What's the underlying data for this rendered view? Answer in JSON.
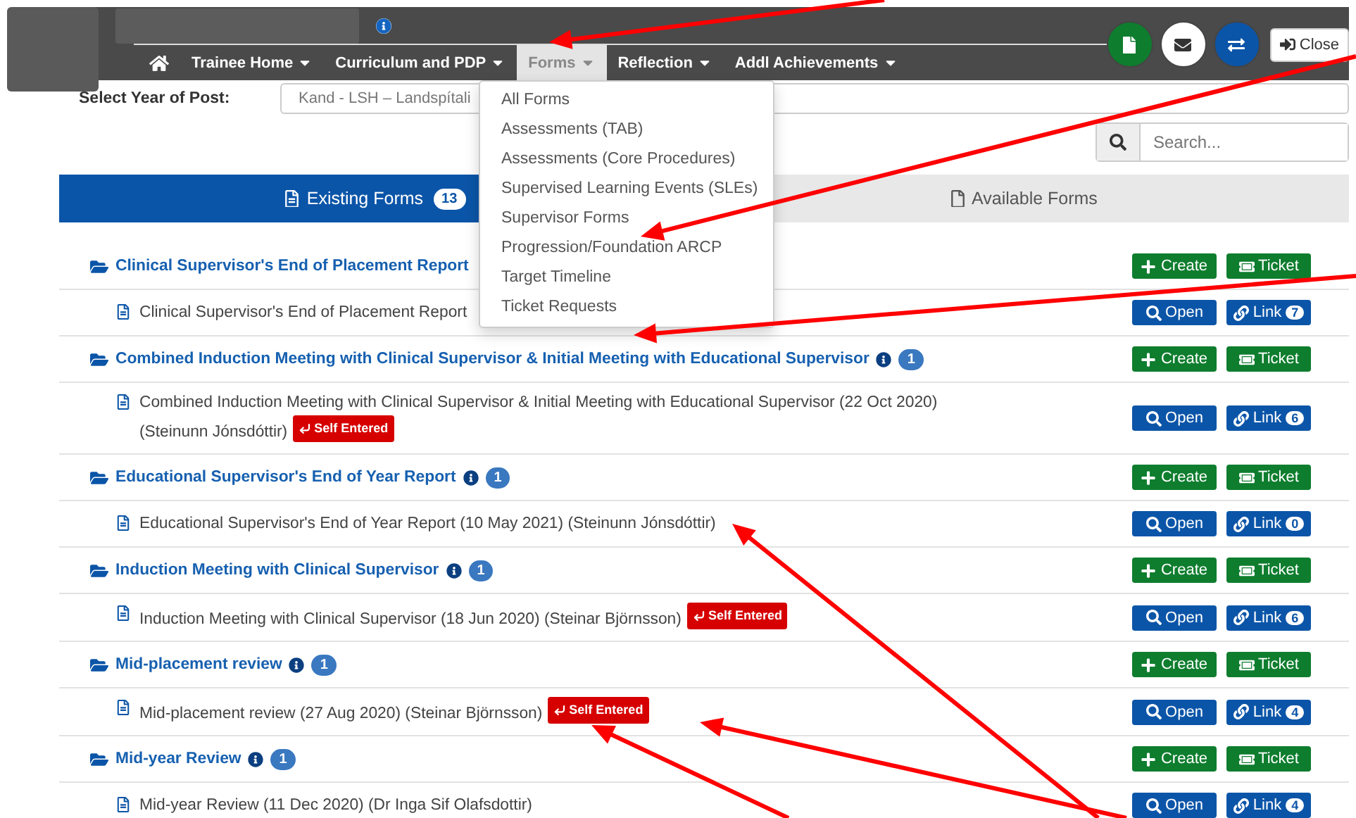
{
  "navbar": {
    "menu": [
      {
        "label": "Trainee Home",
        "selected": false
      },
      {
        "label": "Curriculum and PDP",
        "selected": false
      },
      {
        "label": "Forms",
        "selected": true
      },
      {
        "label": "Reflection",
        "selected": false
      },
      {
        "label": "Addl Achievements",
        "selected": false
      }
    ],
    "close_button": "Close"
  },
  "forms_menu": [
    "All Forms",
    "Assessments (TAB)",
    "Assessments (Core Procedures)",
    "Supervised Learning Events (SLEs)",
    "Supervisor Forms",
    "Progression/Foundation ARCP",
    "Target Timeline",
    "Ticket Requests"
  ],
  "year_select": {
    "label": "Select Year of Post:",
    "value": "Kand - LSH – Landspítali"
  },
  "search": {
    "placeholder": "Search..."
  },
  "tabs": [
    {
      "label": "Existing Forms",
      "count": "13",
      "selected": true
    },
    {
      "label": "Available Forms",
      "selected": false
    }
  ],
  "groups": [
    {
      "title": "Clinical Supervisor's End of Placement Report",
      "actions": [
        {
          "kind": "create",
          "label": "Create"
        },
        {
          "kind": "ticket",
          "label": "Ticket"
        }
      ],
      "items": [
        {
          "text": "Clinical Supervisor's End of Placement Report",
          "actions": [
            {
              "kind": "open",
              "label": "Open"
            },
            {
              "kind": "link",
              "label": "Link",
              "count": "7"
            }
          ]
        }
      ]
    },
    {
      "title": "Combined Induction Meeting with Clinical Supervisor & Initial Meeting with Educational Supervisor",
      "count": "1",
      "actions": [
        {
          "kind": "create",
          "label": "Create"
        },
        {
          "kind": "ticket",
          "label": "Ticket"
        }
      ],
      "items": [
        {
          "text": "Combined Induction Meeting with Clinical Supervisor & Initial Meeting with Educational Supervisor (22 Oct 2020) (Steinunn Jónsdóttir)",
          "badge": "Self Entered",
          "actions": [
            {
              "kind": "open",
              "label": "Open"
            },
            {
              "kind": "link",
              "label": "Link",
              "count": "6"
            }
          ]
        }
      ]
    },
    {
      "title": "Educational Supervisor's End of Year Report",
      "count": "1",
      "actions": [
        {
          "kind": "create",
          "label": "Create"
        },
        {
          "kind": "ticket",
          "label": "Ticket"
        }
      ],
      "items": [
        {
          "text": "Educational Supervisor's End of Year Report (10 May 2021) (Steinunn Jónsdóttir)",
          "actions": [
            {
              "kind": "open",
              "label": "Open"
            },
            {
              "kind": "link",
              "label": "Link",
              "count": "0"
            }
          ]
        }
      ]
    },
    {
      "title": "Induction Meeting with Clinical Supervisor",
      "count": "1",
      "actions": [
        {
          "kind": "create",
          "label": "Create"
        },
        {
          "kind": "ticket",
          "label": "Ticket"
        }
      ],
      "items": [
        {
          "text": "Induction Meeting with Clinical Supervisor (18 Jun 2020) (Steinar Björnsson)",
          "badge": "Self Entered",
          "actions": [
            {
              "kind": "open",
              "label": "Open"
            },
            {
              "kind": "link",
              "label": "Link",
              "count": "6"
            }
          ]
        }
      ]
    },
    {
      "title": "Mid-placement review",
      "count": "1",
      "actions": [
        {
          "kind": "create",
          "label": "Create"
        },
        {
          "kind": "ticket",
          "label": "Ticket"
        }
      ],
      "items": [
        {
          "text": "Mid-placement review (27 Aug 2020) (Steinar Björnsson)",
          "badge": "Self Entered",
          "actions": [
            {
              "kind": "open",
              "label": "Open"
            },
            {
              "kind": "link",
              "label": "Link",
              "count": "4"
            }
          ]
        }
      ]
    },
    {
      "title": "Mid-year Review",
      "count": "1",
      "actions": [
        {
          "kind": "create",
          "label": "Create"
        },
        {
          "kind": "ticket",
          "label": "Ticket"
        }
      ],
      "items": [
        {
          "text": "Mid-year Review (11 Dec 2020) (Dr Inga Sif Olafsdottir)",
          "actions": [
            {
              "kind": "open",
              "label": "Open"
            },
            {
              "kind": "link",
              "label": "Link",
              "count": "4"
            }
          ]
        }
      ]
    }
  ]
}
